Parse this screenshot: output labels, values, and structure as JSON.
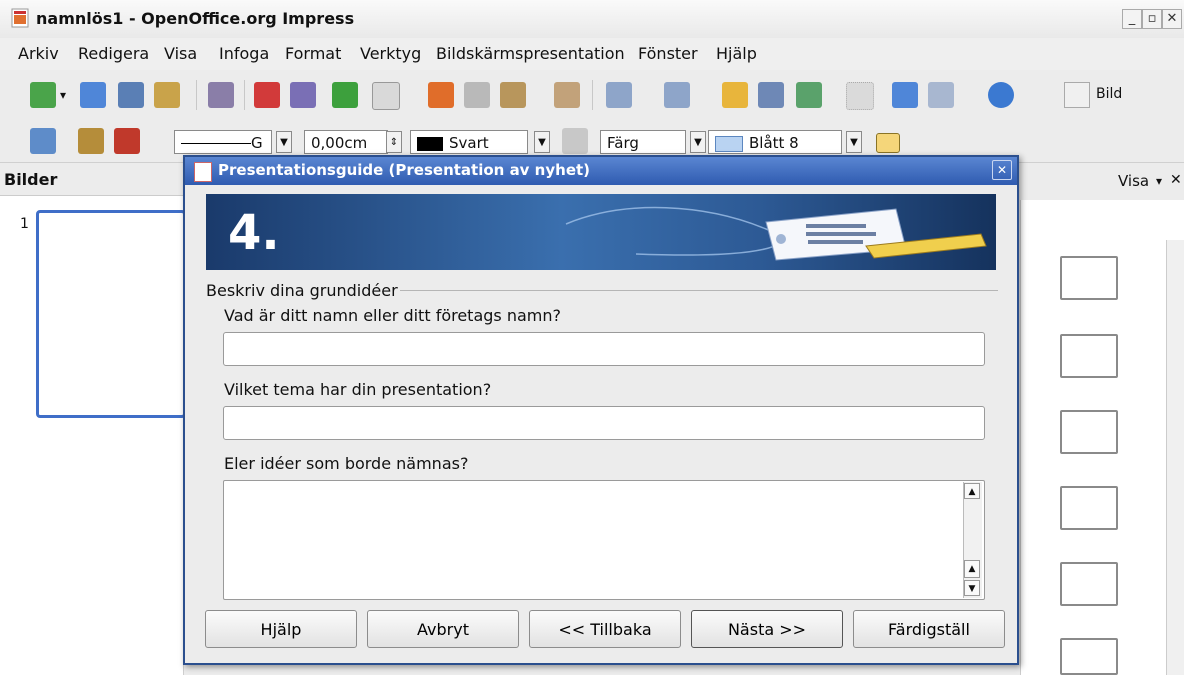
{
  "window": {
    "title": "namnlös1 - OpenOffice.org Impress",
    "buttons": [
      "_",
      " ɑ",
      "✕"
    ]
  },
  "menu": {
    "items": [
      "Arkiv",
      "Redigera",
      "Visa",
      "Infoga",
      "Format",
      "Verktyg",
      "Bildskärmspresentation",
      "Fönster",
      "Hjälp"
    ]
  },
  "toolbar": {
    "new_slide_label": "Bild",
    "line_width": "0,00cm",
    "line_style": "G",
    "line_color": "Svart",
    "area_style": "Färg",
    "area_color": "Blått 8"
  },
  "slides_pane": {
    "title": "Bilder",
    "slide_number": "1"
  },
  "tasks_pane": {
    "view_label": "Visa",
    "close_label": "✕"
  },
  "dialog": {
    "title": "Presentationsguide (Presentation av nyhet)",
    "step": "4.",
    "section_title": "Beskriv dina grundidéer",
    "q1": "Vad är ditt namn eller ditt företags namn?",
    "q2": "Vilket tema har din presentation?",
    "q3": "Eler idéer som borde nämnas?",
    "a1": "",
    "a2": "",
    "a3": "",
    "buttons": {
      "help": "Hjälp",
      "cancel": "Avbryt",
      "back": "<< Tillbaka",
      "next": "Nästa >>",
      "finish": "Färdigställ"
    }
  },
  "colors": {
    "accent": "#2f5bb0",
    "selection_border": "#3f6ec8",
    "line_color_swatch": "#000000",
    "area_color_swatch": "#b9d3f2"
  }
}
